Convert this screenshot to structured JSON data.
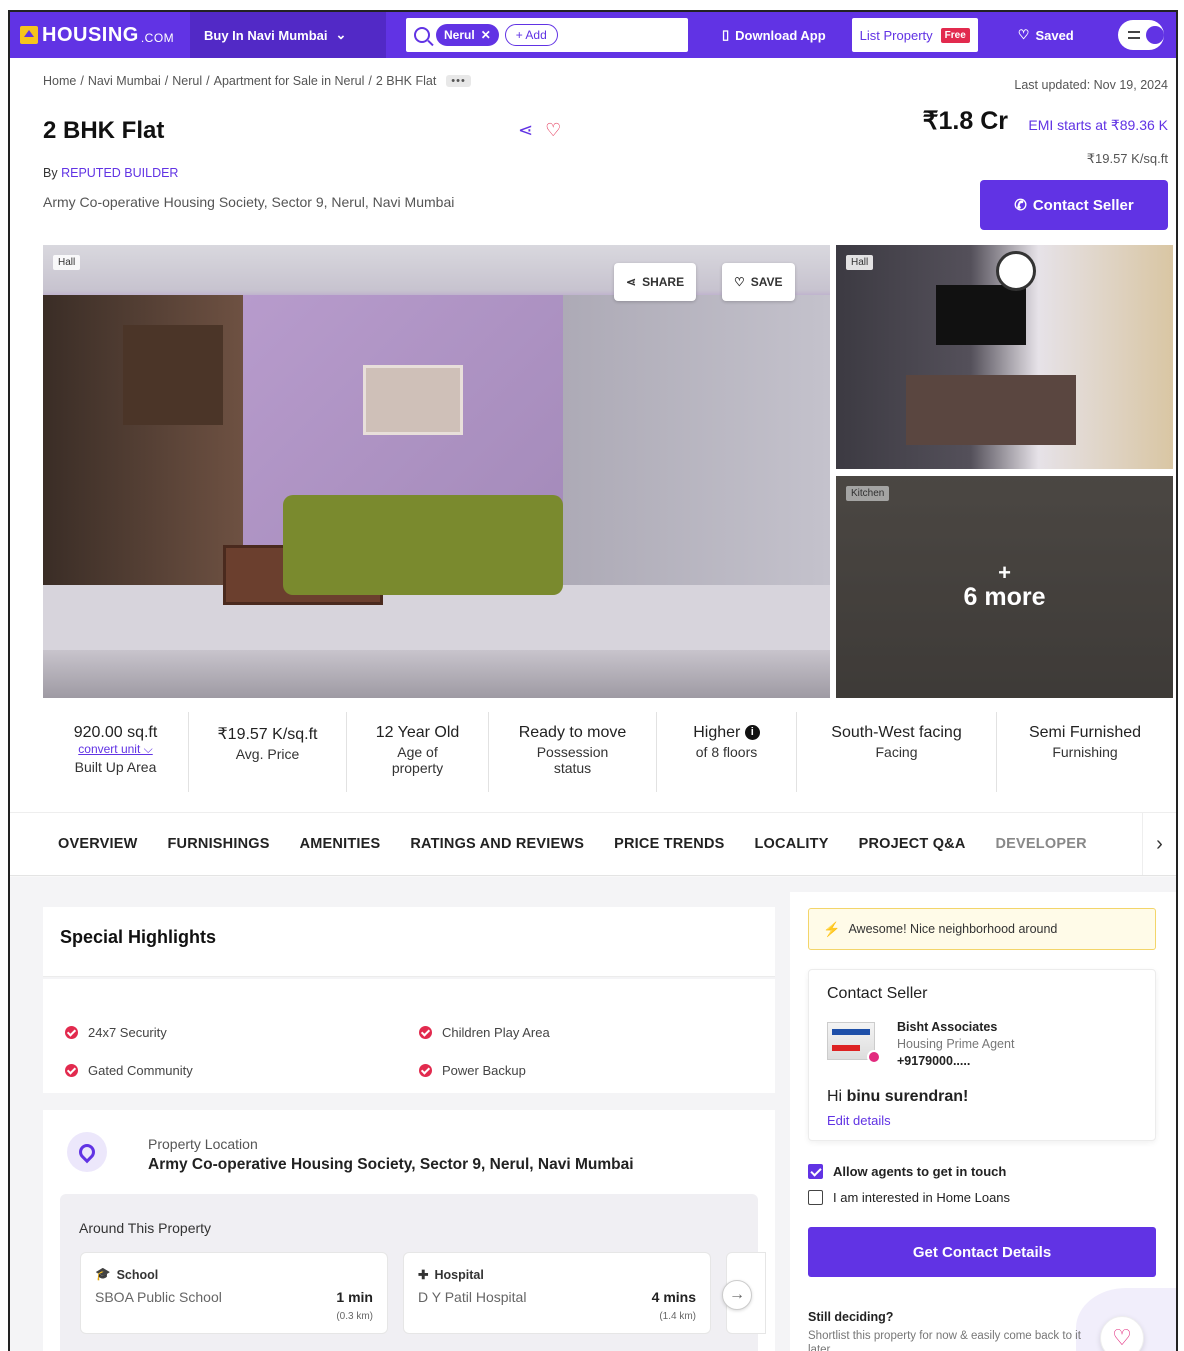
{
  "nav": {
    "logo_text": "HOUSING",
    "logo_suffix": ".COM",
    "city_select": "Buy In Navi Mumbai",
    "search_chip": "Nerul",
    "add_chip": "+ Add",
    "download_app": "Download App",
    "list_property": "List Property",
    "free_badge": "Free",
    "saved": "Saved"
  },
  "breadcrumb": [
    "Home",
    "Navi Mumbai",
    "Nerul",
    "Apartment for Sale in Nerul",
    "2 BHK Flat"
  ],
  "breadcrumb_more": "•••",
  "last_updated": "Last updated: Nov 19, 2024",
  "listing": {
    "title": "2 BHK Flat",
    "by_prefix": "By",
    "builder": "REPUTED BUILDER",
    "address": "Army Co-operative Housing Society, Sector 9, Nerul, Navi Mumbai",
    "price": "₹1.8 Cr",
    "emi": "EMI starts at ₹89.36 K",
    "price_per_sqft": "₹19.57 K/sq.ft",
    "contact_seller": "Contact Seller"
  },
  "gallery": {
    "main_tag": "Hall",
    "share": "SHARE",
    "save": "SAVE",
    "side1_tag": "Hall",
    "side2_tag": "Kitchen",
    "more_plus": "+",
    "more_text": "6 more"
  },
  "stats": [
    {
      "value": "920.00 sq.ft",
      "extra": "convert unit ⌵",
      "label": "Built Up Area"
    },
    {
      "value": "₹19.57 K/sq.ft",
      "label": "Avg. Price"
    },
    {
      "value": "12 Year Old",
      "label": "Age of property"
    },
    {
      "value": "Ready to move",
      "label": "Possession status"
    },
    {
      "value": "Higher",
      "label": "of 8 floors"
    },
    {
      "value": "South-West facing",
      "label": "Facing"
    },
    {
      "value": "Semi Furnished",
      "label": "Furnishing"
    }
  ],
  "tabs": [
    "OVERVIEW",
    "FURNISHINGS",
    "AMENITIES",
    "RATINGS AND REVIEWS",
    "PRICE TRENDS",
    "LOCALITY",
    "PROJECT Q&A",
    "DEVELOPER"
  ],
  "highlights": {
    "title": "Special Highlights",
    "items": [
      "24x7 Security",
      "Children Play Area",
      "Gated Community",
      "Power Backup"
    ]
  },
  "location": {
    "label": "Property Location",
    "value": "Army Co-operative Housing Society, Sector 9, Nerul, Navi Mumbai",
    "around_title": "Around This Property",
    "pois": [
      {
        "category": "School",
        "name": "SBOA Public School",
        "time": "1 min",
        "distance": "(0.3 km)"
      },
      {
        "category": "Hospital",
        "name": "D Y Patil Hospital",
        "time": "4 mins",
        "distance": "(1.4 km)"
      }
    ]
  },
  "sidebar": {
    "awesome": "Awesome! Nice neighborhood around",
    "contact_title": "Contact Seller",
    "agent_name": "Bisht Associates",
    "agent_role": "Housing Prime Agent",
    "agent_phone": "+9179000.....",
    "greet_prefix": "Hi",
    "greet_name": "binu surendran!",
    "edit_details": "Edit details",
    "allow_agents": "Allow agents to get in touch",
    "home_loans": "I am interested in Home Loans",
    "get_contact": "Get Contact Details",
    "still_title": "Still deciding?",
    "still_sub": "Shortlist this property for now & easily come back to it later."
  },
  "colors": {
    "brand": "#6133e4",
    "accent": "#e22a4e"
  }
}
